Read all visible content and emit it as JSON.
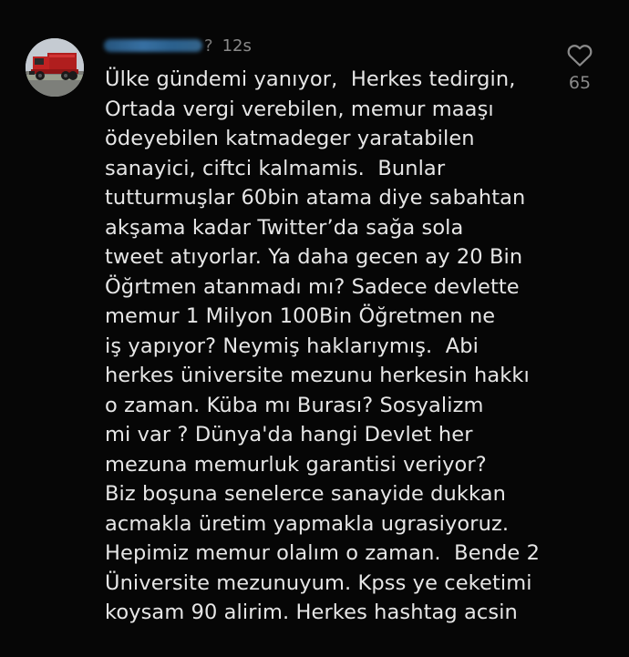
{
  "comment": {
    "username_visible_suffix": "?",
    "time": "12s",
    "likes": "65",
    "lines": [
      "Ülke gündemi yanıyor,  Herkes tedirgin,",
      "Ortada vergi verebilen, memur maaşı",
      "ödeyebilen katmadeger yaratabilen",
      "sanayici, ciftci kalmamis.  Bunlar",
      "tutturmuşlar 60bin atama diye sabahtan",
      "akşama kadar Twitter’da sağa sola",
      "tweet atıyorlar. Ya daha gecen ay 20 Bin",
      "Öğrtmen atanmadı mı? Sadece devlette",
      "memur 1 Milyon 100Bin Öğretmen ne",
      "iş yapıyor? Neymiş haklarıymış.  Abi",
      "herkes üniversite mezunu herkesin hakkı",
      "o zaman. Küba mı Burası? Sosyalizm",
      "mi var ? Dünya'da hangi Devlet her",
      "mezuna memurluk garantisi veriyor?",
      "Biz boşuna senelerce sanayide dukkan",
      "acmakla üretim yapmakla ugrasiyoruz.",
      "Hepimiz memur olalım o zaman.  Bende 2",
      "Üniversite mezunuyum. Kpss ye ceketimi",
      "koysam 90 alirim. Herkes hashtag acsin"
    ],
    "avatar_icon": "red-truck-photo",
    "like_icon": "heart-outline-icon"
  },
  "colors": {
    "background": "#060606",
    "text": "#e6e6e6",
    "muted": "#8a8a8a"
  }
}
